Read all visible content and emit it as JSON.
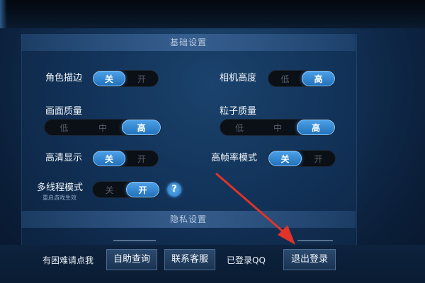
{
  "sections": {
    "basic": "基础设置",
    "privacy": "隐私设置"
  },
  "settings": {
    "outline": {
      "label": "角色描边",
      "options": [
        "关",
        "开"
      ],
      "selected": "关"
    },
    "camera_height": {
      "label": "相机高度",
      "options": [
        "低",
        "高"
      ],
      "selected": "高"
    },
    "graphics_quality": {
      "label": "画面质量",
      "options": [
        "低",
        "中",
        "高"
      ],
      "selected": "高"
    },
    "particle_quality": {
      "label": "粒子质量",
      "options": [
        "低",
        "中",
        "高"
      ],
      "selected": "高"
    },
    "hd_display": {
      "label": "高清显示",
      "options": [
        "关",
        "开"
      ],
      "selected": "关"
    },
    "high_fps": {
      "label": "高帧率模式",
      "options": [
        "关",
        "开"
      ],
      "selected": "关"
    },
    "multithread": {
      "label": "多线程模式",
      "sublabel": "重启游戏生效",
      "options": [
        "关",
        "开"
      ],
      "selected": "开"
    }
  },
  "help_icon": "?",
  "footer": {
    "trouble_label": "有困难请点我",
    "self_service": "自助查询",
    "contact_service": "联系客服",
    "logged_in_label": "已登录QQ",
    "logout": "退出登录"
  },
  "colors": {
    "accent": "#2f86d6",
    "annotation_arrow": "#e0332a"
  },
  "icons": [
    "question-icon",
    "annotation-arrow"
  ]
}
